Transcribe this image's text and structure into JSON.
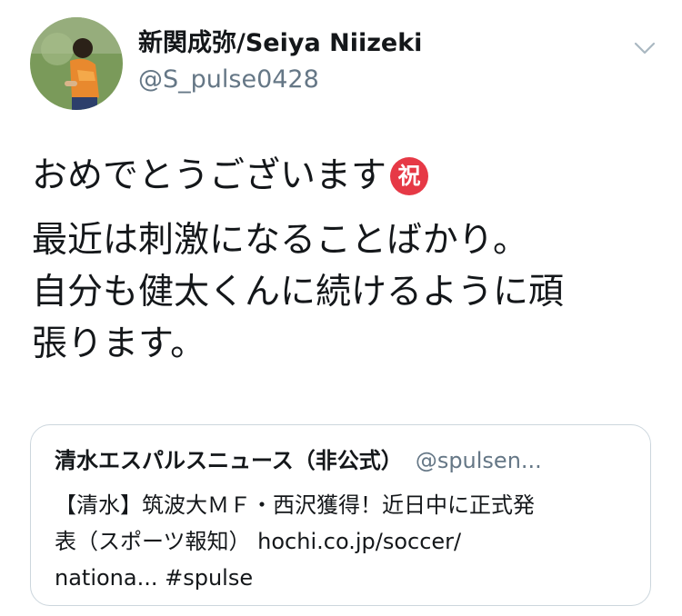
{
  "author": {
    "display_name": "新関成弥/Seiya Niizeki",
    "handle": "@S_pulse0428"
  },
  "tweet": {
    "lines": [
      "おめでとうございます",
      "最近は刺激になることばかり。",
      "自分も健太くんに続けるように頑",
      "張ります。"
    ],
    "emoji": "祝"
  },
  "quoted_tweet": {
    "display_name": "清水エスパルスニュース（非公式）",
    "handle": "@spulsen...",
    "lines": [
      "【清水】筑波大ＭＦ・西沢獲得！近日中に正式発",
      "表（スポーツ報知） hochi.co.jp/soccer/",
      "nationa... #spulse"
    ]
  },
  "icons": {
    "avatar": "profile-photo",
    "menu": "chevron-down-icon",
    "emoji": "congratulations-emoji"
  },
  "colors": {
    "text": "#14171a",
    "secondary_text": "#657786",
    "border": "#ccd6dd",
    "emoji_red": "#e63946"
  }
}
